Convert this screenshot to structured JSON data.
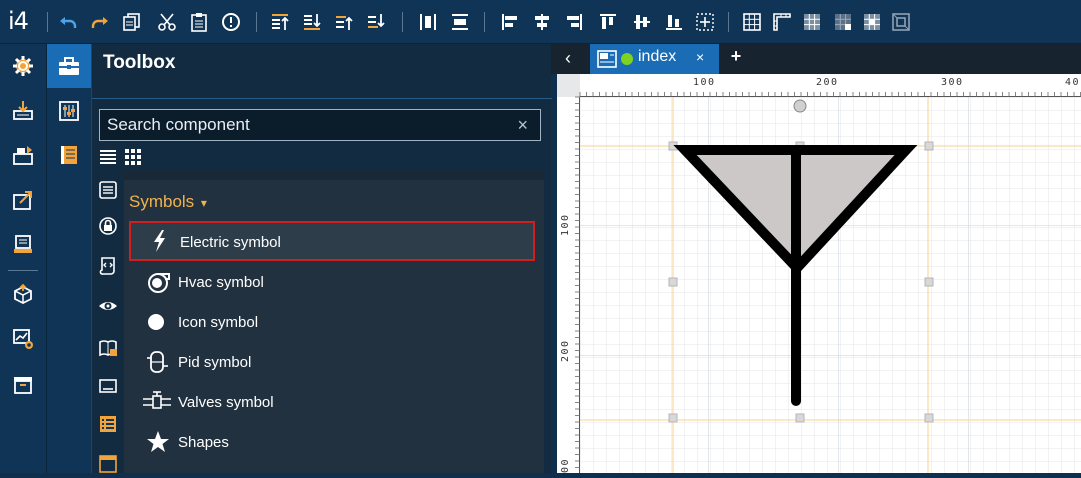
{
  "app": {
    "logo": "i4"
  },
  "toolbox": {
    "title": "Toolbox",
    "search_placeholder": "Search component",
    "clear_glyph": "×",
    "category_header": "Symbols",
    "items": [
      {
        "label": "Electric symbol",
        "icon": "lightning-icon",
        "selected": true
      },
      {
        "label": "Hvac symbol",
        "icon": "hvac-icon"
      },
      {
        "label": "Icon symbol",
        "icon": "circle-icon"
      },
      {
        "label": "Pid symbol",
        "icon": "pid-icon"
      },
      {
        "label": "Valves symbol",
        "icon": "valve-icon"
      },
      {
        "label": "Shapes",
        "icon": "star-icon"
      }
    ]
  },
  "editor": {
    "tab_label": "index",
    "tab_close": "×",
    "tab_add": "+",
    "back_glyph": "‹",
    "ruler_x": [
      "100",
      "200",
      "300",
      "40"
    ],
    "ruler_y": [
      "100",
      "200",
      "00"
    ]
  },
  "colors": {
    "accent": "#f2a43a",
    "blue": "#1a6cb5",
    "selection": "#d11f1f",
    "header": "#f2b34c"
  }
}
